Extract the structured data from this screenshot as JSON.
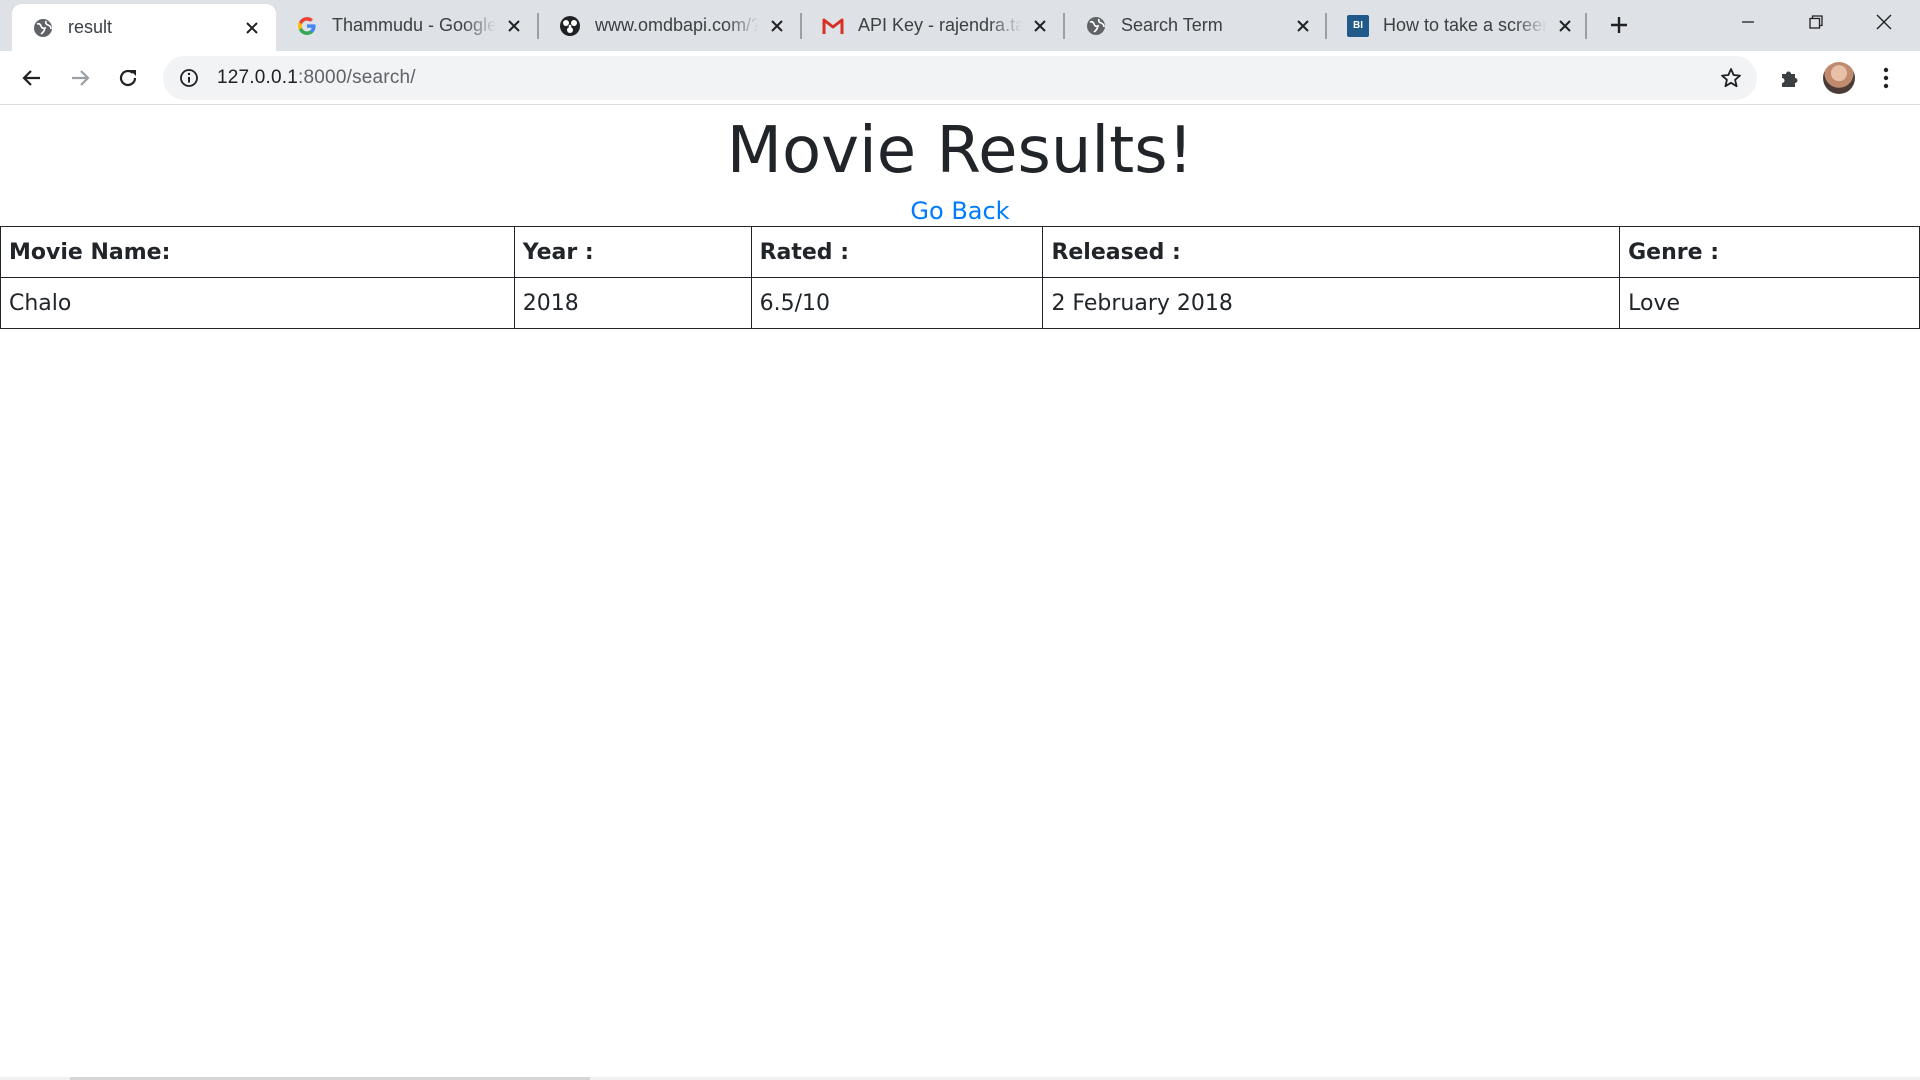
{
  "browser": {
    "tabs": [
      {
        "title": "result",
        "icon": "globe-icon",
        "active": true
      },
      {
        "title": "Thammudu - Google",
        "icon": "google-icon",
        "active": false
      },
      {
        "title": "www.omdbapi.com/?",
        "icon": "omdb-icon",
        "active": false
      },
      {
        "title": "API Key - rajendra.ta",
        "icon": "gmail-icon",
        "active": false
      },
      {
        "title": "Search Term",
        "icon": "globe-icon",
        "active": false
      },
      {
        "title": "How to take a screen",
        "icon": "bi-icon",
        "active": false
      }
    ],
    "bi_icon_text": "BI",
    "url_host": "127.0.0.1",
    "url_rest": ":8000/search/"
  },
  "page": {
    "heading": "Movie Results!",
    "back_link": "Go Back",
    "table": {
      "headers": [
        "Movie Name:",
        "Year :",
        "Rated :",
        "Released :",
        "Genre :"
      ],
      "rows": [
        [
          "Chalo",
          "2018",
          "6.5/10",
          "2 February 2018",
          "Love"
        ]
      ]
    }
  },
  "colors": {
    "link": "#007bff",
    "text": "#212529",
    "tabstrip": "#dee1e6",
    "omnibox": "#f1f3f4",
    "gmail_red": "#d93025",
    "bi_blue": "#1f5a8a"
  }
}
